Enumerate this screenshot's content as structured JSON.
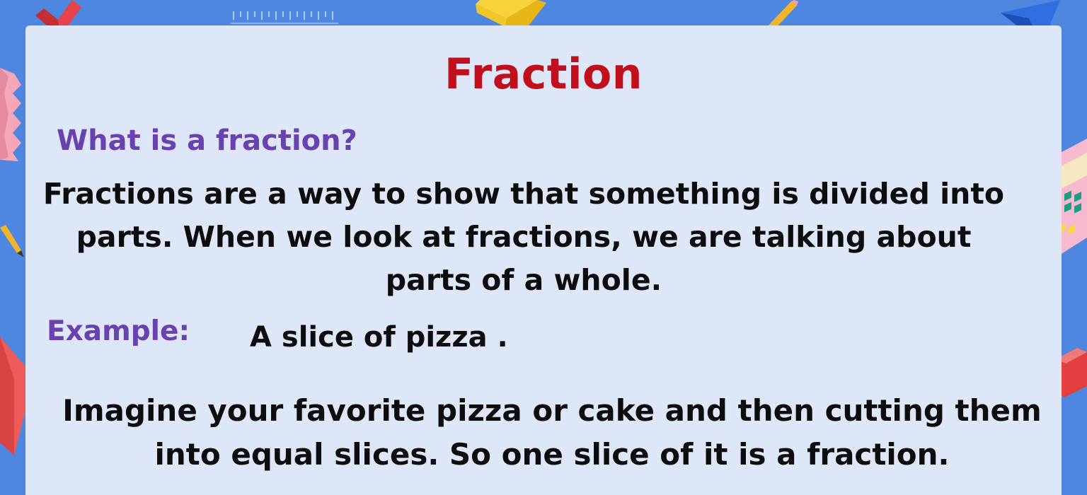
{
  "slide": {
    "title": "Fraction",
    "question": "What is a fraction?",
    "definition": "Fractions are a way to show that something is divided into parts. When we look at fractions, we are talking about parts of a whole.",
    "example_label": "Example:",
    "example_text": "A slice of pizza .",
    "explanation": "Imagine your favorite pizza or cake and then cutting them into equal slices. So one slice of it is a fraction."
  },
  "colors": {
    "background": "#4f86e0",
    "board": "#dde7f8",
    "title": "#c0101b",
    "heading": "#6a42b0",
    "body_text": "#0d0d0d"
  },
  "decorations": [
    "ruler-icon",
    "red-block-icon",
    "yellow-block-icon",
    "pencil-icon",
    "blue-triangle-icon",
    "pink-blocks-icon",
    "calculator-icon",
    "red-diamond-icon",
    "red-cube-icon"
  ]
}
